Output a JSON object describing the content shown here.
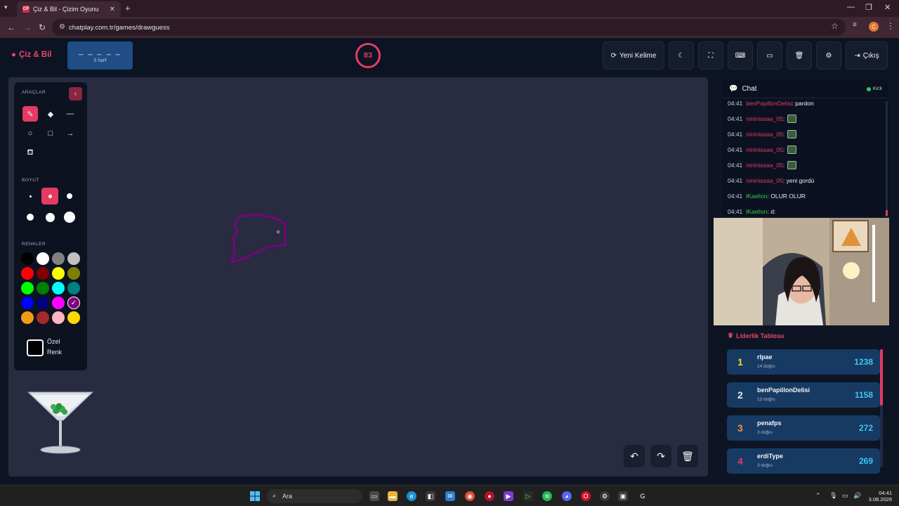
{
  "browser": {
    "tab_title": "Çiz & Bil - Çizim Oyunu",
    "tab_favicon_text": "CP",
    "url": "chatplay.com.tr/games/drawguess",
    "profile_initial": "C"
  },
  "header": {
    "logo": "Çiz & Bil",
    "word_mask": "_ _ _ _ _",
    "word_hint": "5 harf",
    "timer": "83",
    "new_word_label": "Yeni Kelime",
    "exit_label": "Çıkış"
  },
  "tools": {
    "section_tools": "ARAÇLAR",
    "section_size": "BOYUT",
    "section_colors": "RENKLER",
    "custom_label_1": "Özel",
    "custom_label_2": "Renk",
    "colors": [
      "#000000",
      "#ffffff",
      "#808080",
      "#c0c0c0",
      "#ff0000",
      "#800000",
      "#ffff00",
      "#808000",
      "#00ff00",
      "#008000",
      "#00ffff",
      "#008080",
      "#0000ff",
      "#000080",
      "#ff00ff",
      "#800080",
      "#f39c12",
      "#a52a2a",
      "#ffb6c1",
      "#ffd700"
    ],
    "selected_color": "#800080",
    "selected_size_index": 1
  },
  "chat": {
    "title": "Chat",
    "platform": "Kick",
    "messages": [
      {
        "time": "04:41",
        "user": "benPapillonDelisi",
        "user_color": "#e53a63",
        "text": "pardon",
        "emote": false
      },
      {
        "time": "04:41",
        "user": "nininisaaa_05",
        "user_color": "#e53a63",
        "text": "",
        "emote": true
      },
      {
        "time": "04:41",
        "user": "nininisaaa_05",
        "user_color": "#e53a63",
        "text": "",
        "emote": true
      },
      {
        "time": "04:41",
        "user": "nininisaaa_05",
        "user_color": "#e53a63",
        "text": "",
        "emote": true
      },
      {
        "time": "04:41",
        "user": "nininisaaa_05",
        "user_color": "#e53a63",
        "text": "",
        "emote": true
      },
      {
        "time": "04:41",
        "user": "nininisaaa_05",
        "user_color": "#e53a63",
        "text": "yeni gordü",
        "emote": false
      },
      {
        "time": "04:41",
        "user": "lKaelion",
        "user_color": "#2ecc53",
        "text": "OLUR OLUR",
        "emote": false
      },
      {
        "time": "04:41",
        "user": "lKaelion",
        "user_color": "#2ecc53",
        "text": "d:",
        "emote": false
      }
    ]
  },
  "leaderboard": {
    "title": "Liderlik Tablosu",
    "rows": [
      {
        "rank": "1",
        "rank_color": "#f5d327",
        "name": "rlpae",
        "sub": "14 doğru",
        "score": "1238"
      },
      {
        "rank": "2",
        "rank_color": "#e4e8ef",
        "name": "benPapillonDelisi",
        "sub": "13 doğru",
        "score": "1158"
      },
      {
        "rank": "3",
        "rank_color": "#f0922d",
        "name": "penafps",
        "sub": "3 doğru",
        "score": "272"
      },
      {
        "rank": "4",
        "rank_color": "#e53a63",
        "name": "erdiType",
        "sub": "3 doğru",
        "score": "269"
      }
    ]
  },
  "taskbar": {
    "search": "Ara",
    "time": "04:41",
    "date": "3.08.2026"
  }
}
